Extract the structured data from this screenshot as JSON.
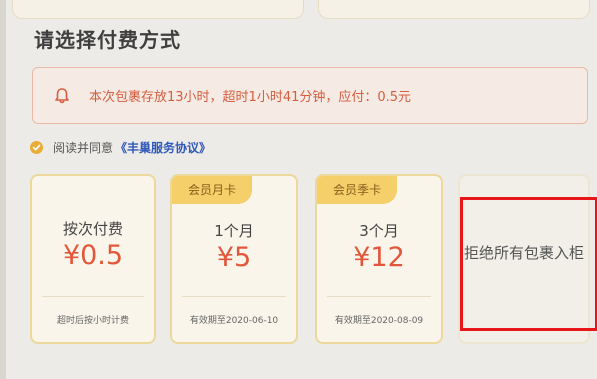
{
  "title": "请选择付费方式",
  "notice": {
    "icon": "bell-icon",
    "text": "本次包裹存放13小时，超时1小时41分钟，应付：0.5元"
  },
  "agreement": {
    "prefix": "阅读并同意",
    "link": "《丰巢服务协议》",
    "checked": true
  },
  "plans": [
    {
      "name": "按次付费",
      "price": "¥0.5",
      "note": "超时后按小时计费"
    },
    {
      "tag": "会员月卡",
      "name": "1个月",
      "price": "¥5",
      "note": "有效期至2020-06-10"
    },
    {
      "tag": "会员季卡",
      "name": "3个月",
      "price": "¥12",
      "note": "有效期至2020-08-09"
    },
    {
      "name": "拒绝所有包裹入柜"
    }
  ],
  "colors": {
    "accent": "#e7ad36",
    "price": "#e2573b",
    "notice_text": "#d45d3e",
    "highlight": "#e8161b"
  }
}
